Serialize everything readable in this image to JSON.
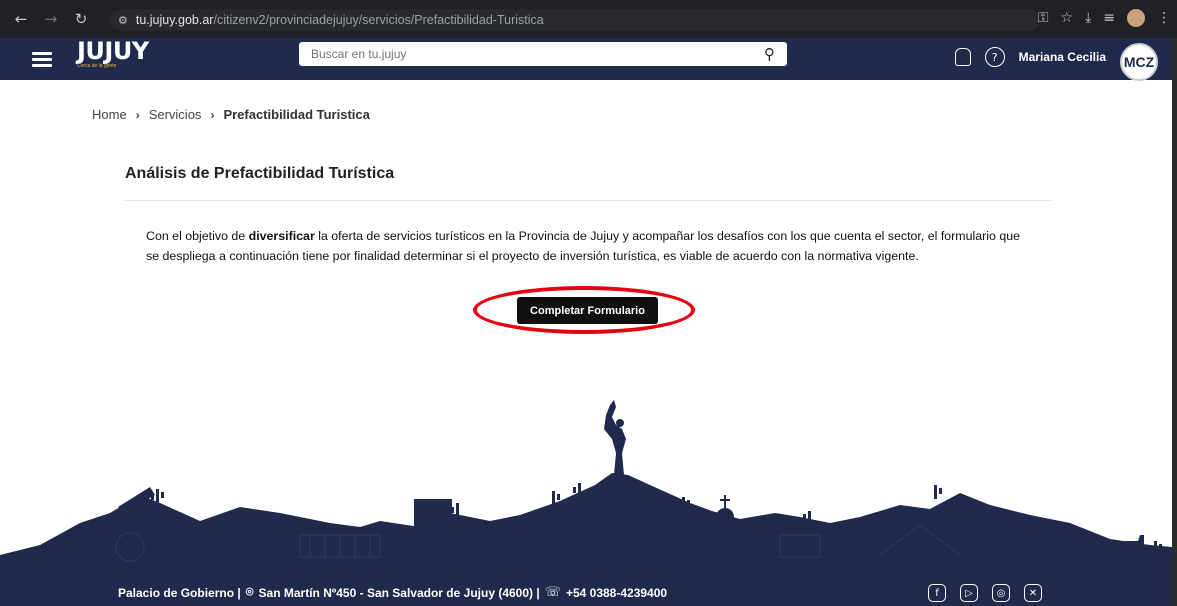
{
  "browser": {
    "url_host": "tu.jujuy.gob.ar",
    "url_path": "/citizenv2/provinciadejujuy/servicios/Prefactibilidad-Turistica"
  },
  "header": {
    "logo": "JUJUY",
    "logo_tagline": "Cerca de la gente",
    "search_placeholder": "Buscar en tu.jujuy",
    "user_name": "Mariana Cecilia",
    "user_initials": "MCZ"
  },
  "breadcrumb": {
    "home": "Home",
    "services": "Servicios",
    "current": "Prefactibilidad Turistica"
  },
  "main": {
    "title": "Análisis de Prefactibilidad Turística",
    "desc_pre": "Con el objetivo de ",
    "desc_bold": "diversificar",
    "desc_post": " la oferta de servicios turísticos en la Provincia de Jujuy y acompañar los desafíos con los que cuenta el sector, el formulario que se despliega a continuación tiene por finalidad determinar si el proyecto de inversión turística, es viable de acuerdo con la normativa vigente.",
    "button_label": "Completar Formulario"
  },
  "footer": {
    "place": "Palacio de Gobierno |",
    "address": "San Martín Nº450 - San Salvador de Jujuy (4600) |",
    "phone": "+54 0388-4239400"
  },
  "colors": {
    "navy": "#1f2a4c",
    "annotation_red": "#e60012"
  }
}
